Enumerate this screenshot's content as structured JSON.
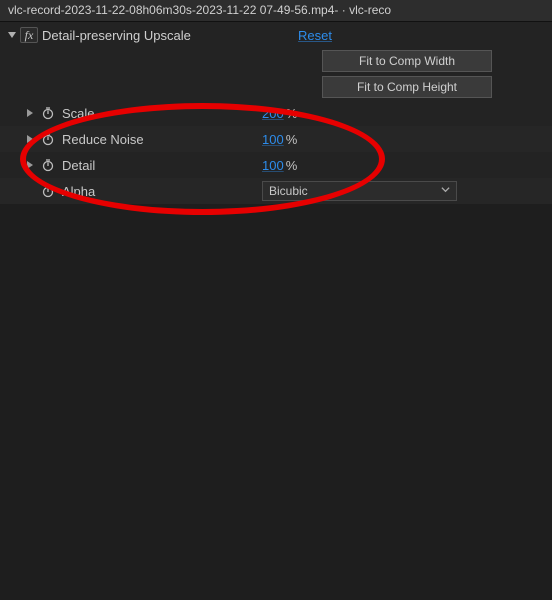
{
  "titlebar": "vlc-record-2023-11-22-08h06m30s-2023-11-22 07-49-56.mp4- · vlc-reco",
  "effect": {
    "name": "Detail-preserving Upscale",
    "reset": "Reset",
    "fit_width": "Fit to Comp Width",
    "fit_height": "Fit to Comp Height"
  },
  "props": {
    "scale": {
      "label": "Scale",
      "value": "200",
      "unit": "%"
    },
    "reduce_noise": {
      "label": "Reduce Noise",
      "value": "100",
      "unit": "%"
    },
    "detail": {
      "label": "Detail",
      "value": "100",
      "unit": "%"
    },
    "alpha": {
      "label": "Alpha",
      "selected": "Bicubic"
    }
  }
}
